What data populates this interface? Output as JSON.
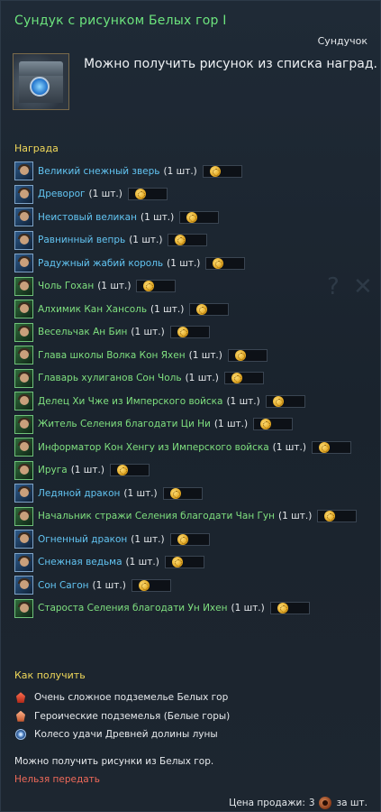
{
  "item": {
    "title": "Сундук с рисунком Белых гор I",
    "type": "Сундучок",
    "description": "Можно получить рисунок из списка наград."
  },
  "rewards": {
    "heading": "Награда",
    "items": [
      {
        "name": "Великий снежный зверь",
        "qty": "(1 шт.)",
        "color": "blue"
      },
      {
        "name": "Древорог",
        "qty": "(1 шт.)",
        "color": "blue"
      },
      {
        "name": "Неистовый великан",
        "qty": "(1 шт.)",
        "color": "blue"
      },
      {
        "name": "Равнинный вепрь",
        "qty": "(1 шт.)",
        "color": "blue"
      },
      {
        "name": "Радужный жабий король",
        "qty": "(1 шт.)",
        "color": "blue"
      },
      {
        "name": "Чоль Гохан",
        "qty": "(1 шт.)",
        "color": "green"
      },
      {
        "name": "Алхимик Кан Хансоль",
        "qty": "(1 шт.)",
        "color": "green"
      },
      {
        "name": "Весельчак Ан Бин",
        "qty": "(1 шт.)",
        "color": "green"
      },
      {
        "name": "Глава школы Волка Кон Яхен",
        "qty": "(1 шт.)",
        "color": "green"
      },
      {
        "name": "Главарь хулиганов Сон Чоль",
        "qty": "(1 шт.)",
        "color": "green"
      },
      {
        "name": "Делец Хи Чже из Имперского войска",
        "qty": "(1 шт.)",
        "color": "green"
      },
      {
        "name": "Житель Селения благодати Ци Ни",
        "qty": "(1 шт.)",
        "color": "green"
      },
      {
        "name": "Информатор Кон Хенгу из Имперского войска",
        "qty": "(1 шт.)",
        "color": "green"
      },
      {
        "name": "Ируга",
        "qty": "(1 шт.)",
        "color": "green"
      },
      {
        "name": "Ледяной дракон",
        "qty": "(1 шт.)",
        "color": "blue"
      },
      {
        "name": "Начальник стражи Селения благодати Чан Гун",
        "qty": "(1 шт.)",
        "color": "green"
      },
      {
        "name": "Огненный дракон",
        "qty": "(1 шт.)",
        "color": "blue"
      },
      {
        "name": "Снежная ведьма",
        "qty": "(1 шт.)",
        "color": "blue"
      },
      {
        "name": "Сон Сагон",
        "qty": "(1 шт.)",
        "color": "blue"
      },
      {
        "name": "Староста Селения благодати Ун Ихен",
        "qty": "(1 шт.)",
        "color": "green"
      }
    ]
  },
  "obtain": {
    "heading": "Как получить",
    "sources": [
      {
        "icon": "dungeon-hard-icon",
        "label": "Очень сложное подземелье Белых гор"
      },
      {
        "icon": "dungeon-heroic-icon",
        "label": "Героические подземелья (Белые горы)"
      },
      {
        "icon": "wheel-of-fortune-icon",
        "label": "Колесо удачи Древней долины луны"
      }
    ]
  },
  "note": "Можно получить рисунки из Белых гор.",
  "trade_status": "Нельзя передать",
  "price": {
    "label": "Цена продажи:",
    "amount": "3",
    "unit": "за шт."
  },
  "colors": {
    "title": "#6ce37d",
    "section_heading": "#f0d85a",
    "reward_blue": "#62c4f2",
    "reward_green": "#7fe07f",
    "warning": "#f06a5a"
  }
}
